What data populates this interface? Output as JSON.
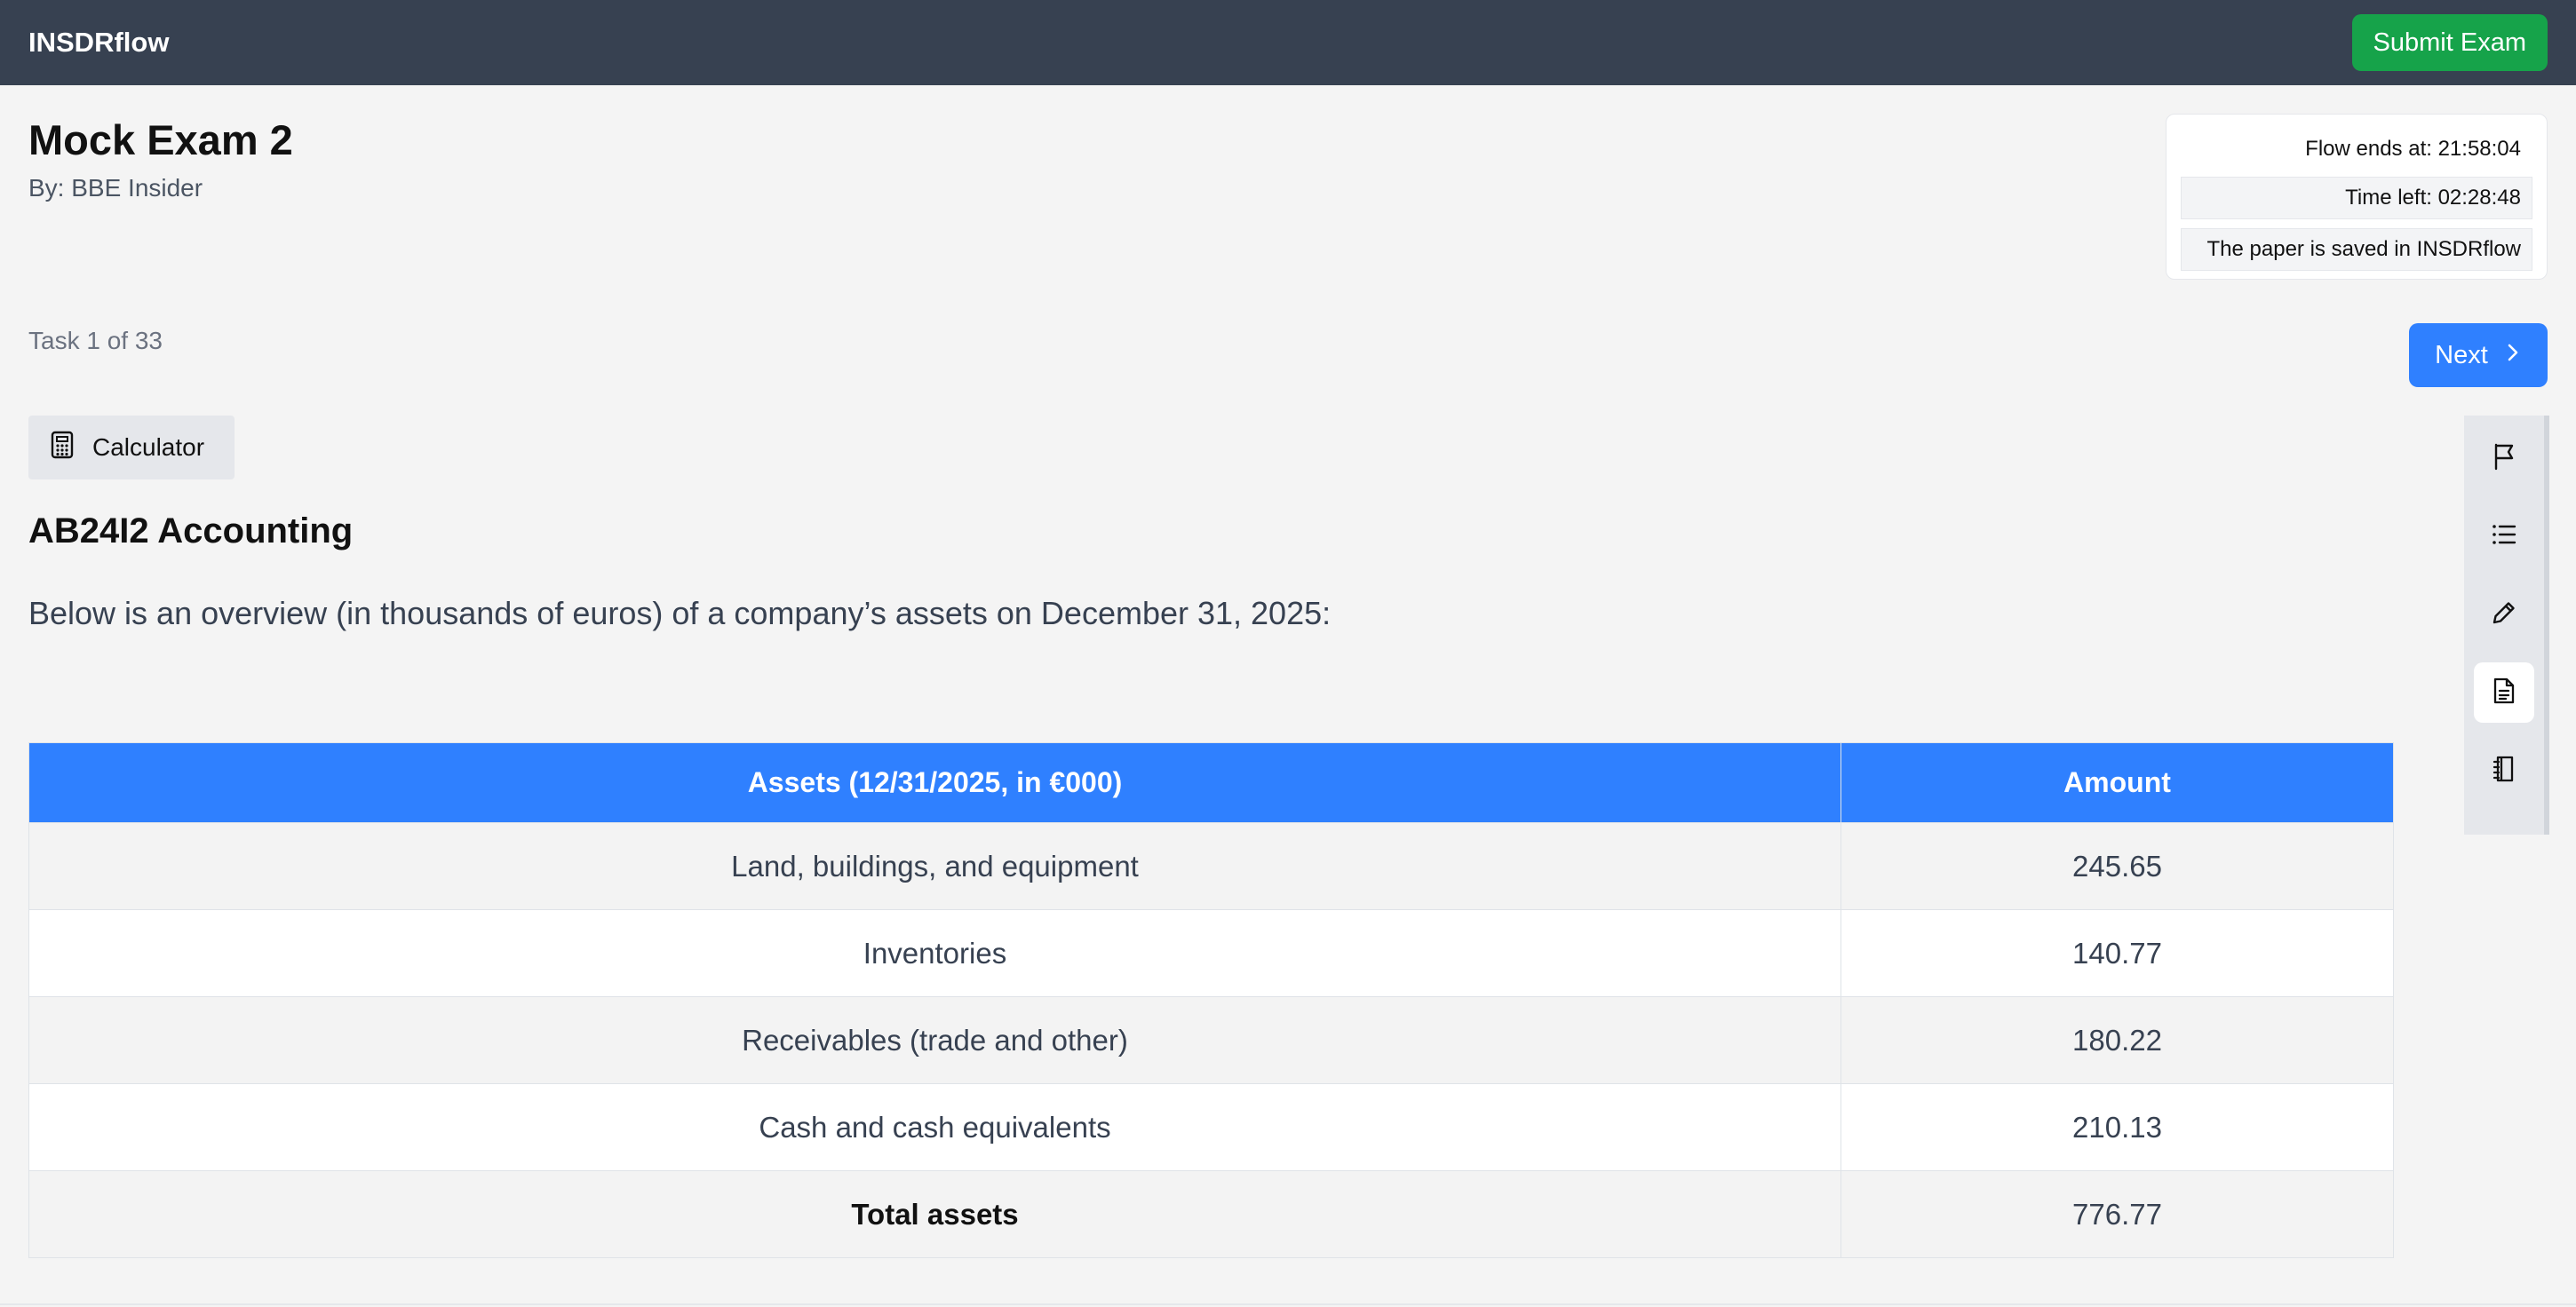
{
  "header": {
    "brand": "INSDRflow",
    "submit_label": "Submit Exam"
  },
  "exam": {
    "title": "Mock Exam 2",
    "byline": "By: BBE Insider"
  },
  "info": {
    "flow_ends": "Flow ends at: 21:58:04",
    "time_left": "Time left: 02:28:48",
    "saved": "The paper is saved in INSDRflow"
  },
  "nav": {
    "task_counter": "Task 1 of 33",
    "next_label": "Next"
  },
  "tools": {
    "calculator_label": "Calculator"
  },
  "task": {
    "section_title": "AB24I2 Accounting",
    "intro": "Below is an overview (in thousands of euros) of a company’s assets on December 31, 2025:"
  },
  "table": {
    "headers": [
      "Assets (12/31/2025, in €000)",
      "Amount"
    ],
    "rows": [
      [
        "Land, buildings, and equipment",
        "245.65"
      ],
      [
        "Inventories",
        "140.77"
      ],
      [
        "Receivables (trade and other)",
        "180.22"
      ],
      [
        "Cash and cash equivalents",
        "210.13"
      ],
      [
        "Total assets",
        "776.77"
      ]
    ]
  },
  "sidebar": {
    "icons": [
      "flag-icon",
      "list-icon",
      "pencil-icon",
      "document-icon",
      "notebook-icon"
    ],
    "active": "document-icon"
  },
  "colors": {
    "topbar": "#374151",
    "submit": "#16a34a",
    "accent": "#2f80ff"
  }
}
